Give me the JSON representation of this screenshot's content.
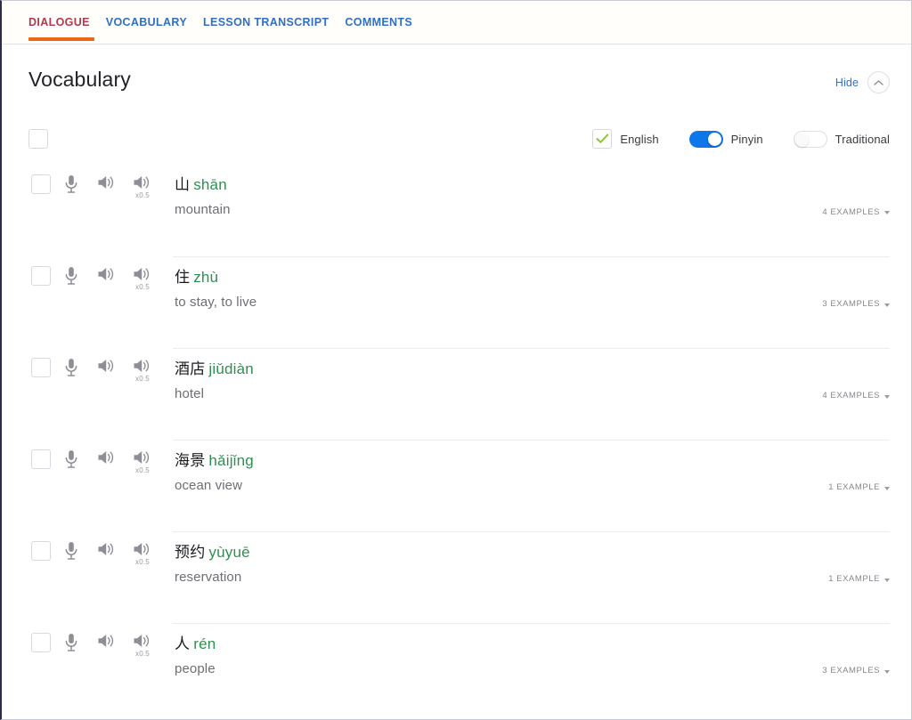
{
  "tabs": [
    {
      "label": "DIALOGUE",
      "active": true
    },
    {
      "label": "VOCABULARY",
      "active": false
    },
    {
      "label": "LESSON TRANSCRIPT",
      "active": false
    },
    {
      "label": "COMMENTS",
      "active": false
    }
  ],
  "section": {
    "title": "Vocabulary",
    "hide_label": "Hide",
    "collapse_icon": "chevron-up-icon"
  },
  "display_options": [
    {
      "name": "english",
      "label": "English",
      "control": "checkbox",
      "state": "checked"
    },
    {
      "name": "pinyin",
      "label": "Pinyin",
      "control": "switch",
      "state": "on"
    },
    {
      "name": "traditional",
      "label": "Traditional",
      "control": "switch",
      "state": "off"
    }
  ],
  "row_controls": {
    "checkbox": "select-checkbox",
    "record": "microphone-icon",
    "play": "speaker-icon",
    "play_slow": "speaker-icon",
    "speed_label": "x0.5"
  },
  "colors": {
    "accent": "#ec6618",
    "tab_active": "#b03a52",
    "tab_inactive": "#2f6fc4",
    "pinyin": "#2f8f52",
    "switch_on": "#0d76e8",
    "check": "#8cc63f"
  },
  "vocabulary": [
    {
      "hanzi": "山",
      "pinyin": "shān",
      "meaning": "mountain",
      "examples": "4 EXAMPLES"
    },
    {
      "hanzi": "住",
      "pinyin": "zhù",
      "meaning": "to stay, to live",
      "examples": "3 EXAMPLES"
    },
    {
      "hanzi": "酒店",
      "pinyin": "jiǔdiàn",
      "meaning": "hotel",
      "examples": "4 EXAMPLES"
    },
    {
      "hanzi": "海景",
      "pinyin": "hǎijǐng",
      "meaning": "ocean view",
      "examples": "1 EXAMPLE"
    },
    {
      "hanzi": "预约",
      "pinyin": "yùyuē",
      "meaning": "reservation",
      "examples": "1 EXAMPLE"
    },
    {
      "hanzi": "人",
      "pinyin": "rén",
      "meaning": "people",
      "examples": "3 EXAMPLES"
    }
  ]
}
